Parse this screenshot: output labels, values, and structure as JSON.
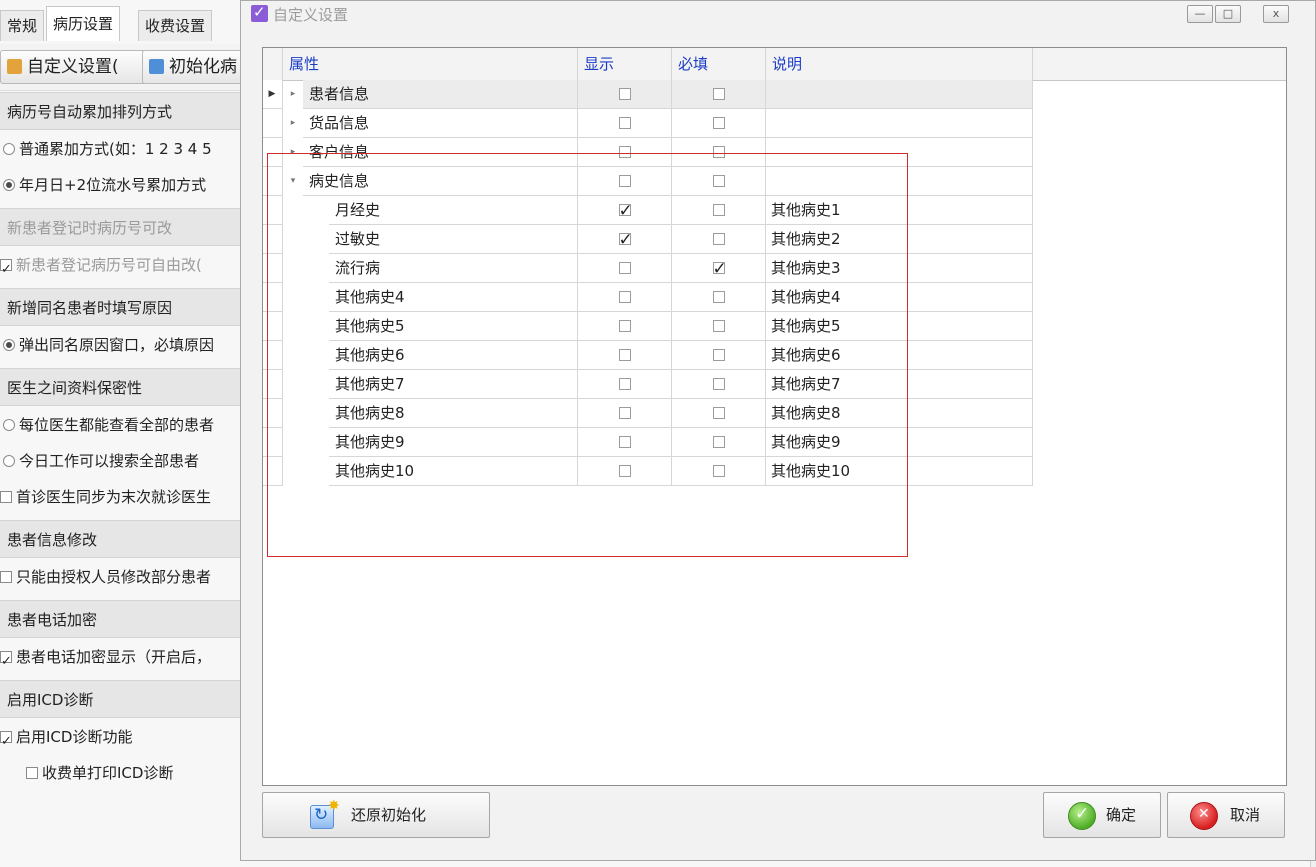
{
  "background": {
    "tabs": [
      "常规",
      "病历设置",
      "收费设置"
    ],
    "toolbar": {
      "custom_label": "自定义设置(",
      "init_label": "初始化病"
    },
    "sections": [
      {
        "title": "病历号自动累加排列方式",
        "disabled": false,
        "options": [
          {
            "type": "radio",
            "checked": false,
            "label": "普通累加方式(如：1 2 3 4 5"
          },
          {
            "type": "radio",
            "checked": true,
            "label": "年月日+2位流水号累加方式"
          }
        ]
      },
      {
        "title": "新患者登记时病历号可改",
        "disabled": true,
        "options": [
          {
            "type": "check",
            "checked": true,
            "label": "新患者登记病历号可自由改("
          }
        ]
      },
      {
        "title": "新增同名患者时填写原因",
        "disabled": false,
        "options": [
          {
            "type": "radio",
            "checked": true,
            "label": "弹出同名原因窗口，必填原因"
          }
        ]
      },
      {
        "title": "医生之间资料保密性",
        "disabled": false,
        "options": [
          {
            "type": "radio",
            "checked": false,
            "label": "每位医生都能查看全部的患者"
          },
          {
            "type": "radio",
            "checked": false,
            "label": "今日工作可以搜索全部患者"
          },
          {
            "type": "check",
            "checked": false,
            "label": "首诊医生同步为末次就诊医生"
          }
        ]
      },
      {
        "title": "患者信息修改",
        "disabled": false,
        "options": [
          {
            "type": "check",
            "checked": false,
            "label": "只能由授权人员修改部分患者"
          }
        ]
      },
      {
        "title": "患者电话加密",
        "disabled": false,
        "options": [
          {
            "type": "check",
            "checked": true,
            "label": "患者电话加密显示（开启后，"
          }
        ]
      },
      {
        "title": "启用ICD诊断",
        "disabled": false,
        "options": [
          {
            "type": "check",
            "checked": true,
            "label": "启用ICD诊断功能"
          },
          {
            "type": "check",
            "checked": false,
            "label": "收费单打印ICD诊断",
            "indent": true
          }
        ]
      }
    ]
  },
  "dialog": {
    "title": "自定义设置",
    "window_buttons": {
      "minimize": "—",
      "maximize": "□",
      "close": "x"
    },
    "grid": {
      "headers": {
        "property": "属性",
        "show": "显示",
        "required": "必填",
        "desc": "说明"
      },
      "rows": [
        {
          "name": "患者信息",
          "level": 0,
          "expander": "collapsed",
          "show": false,
          "required": false,
          "desc": "",
          "current": true
        },
        {
          "name": "货品信息",
          "level": 0,
          "expander": "collapsed",
          "show": false,
          "required": false,
          "desc": ""
        },
        {
          "name": "客户信息",
          "level": 0,
          "expander": "collapsed",
          "show": false,
          "required": false,
          "desc": ""
        },
        {
          "name": "病史信息",
          "level": 0,
          "expander": "expanded",
          "show": false,
          "required": false,
          "desc": ""
        },
        {
          "name": "月经史",
          "level": 1,
          "show": true,
          "required": false,
          "desc": "其他病史1"
        },
        {
          "name": "过敏史",
          "level": 1,
          "show": true,
          "required": false,
          "desc": "其他病史2"
        },
        {
          "name": "流行病",
          "level": 1,
          "show": false,
          "required": true,
          "desc": "其他病史3"
        },
        {
          "name": "其他病史4",
          "level": 1,
          "show": false,
          "required": false,
          "desc": "其他病史4"
        },
        {
          "name": "其他病史5",
          "level": 1,
          "show": false,
          "required": false,
          "desc": "其他病史5"
        },
        {
          "name": "其他病史6",
          "level": 1,
          "show": false,
          "required": false,
          "desc": "其他病史6"
        },
        {
          "name": "其他病史7",
          "level": 1,
          "show": false,
          "required": false,
          "desc": "其他病史7"
        },
        {
          "name": "其他病史8",
          "level": 1,
          "show": false,
          "required": false,
          "desc": "其他病史8"
        },
        {
          "name": "其他病史9",
          "level": 1,
          "show": false,
          "required": false,
          "desc": "其他病史9"
        },
        {
          "name": "其他病史10",
          "level": 1,
          "show": false,
          "required": false,
          "desc": "其他病史10"
        }
      ]
    },
    "buttons": {
      "reset": "还原初始化",
      "ok": "确定",
      "cancel": "取消"
    },
    "highlight_color": "#d02a2a"
  }
}
